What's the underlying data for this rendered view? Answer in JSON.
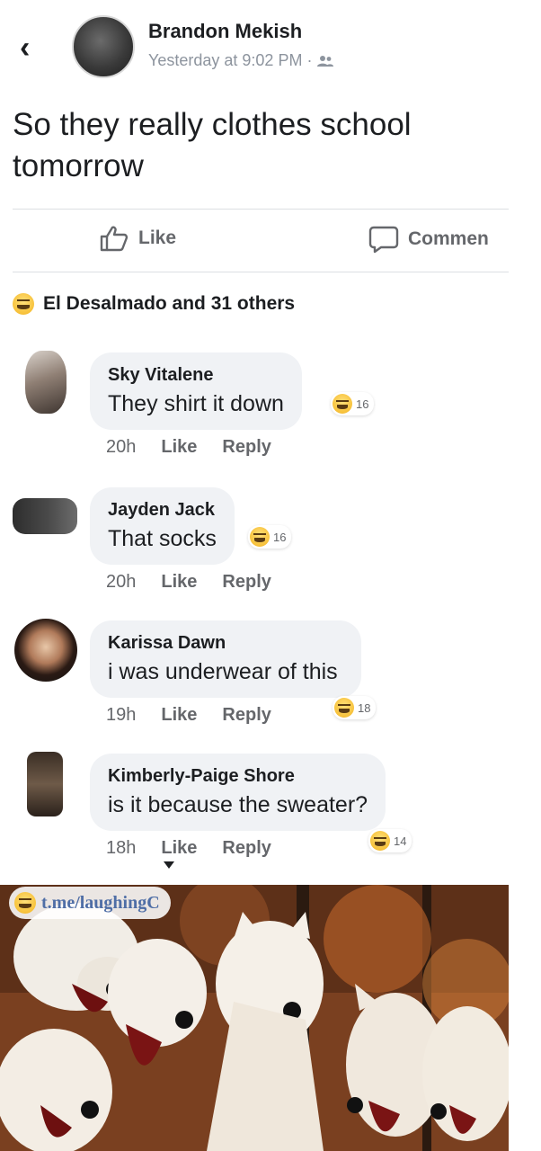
{
  "post": {
    "author": "Brandon Mekish",
    "meta": "Yesterday at 9:02 PM ·",
    "audience_icon": "friends-icon",
    "text": "So they really clothes school tomorrow"
  },
  "actions": {
    "like_label": "Like",
    "comment_label": "Commen"
  },
  "reactions": {
    "summary": "El Desalmado and 31 others",
    "icon": "haha-icon"
  },
  "comments": [
    {
      "name": "Sky Vitalene",
      "text": "They shirt it down",
      "reaction_count": "16",
      "time": "20h",
      "like": "Like",
      "reply": "Reply"
    },
    {
      "name": "Jayden Jack",
      "text": "That socks",
      "reaction_count": "16",
      "time": "20h",
      "like": "Like",
      "reply": "Reply"
    },
    {
      "name": "Karissa Dawn",
      "text": "i was underwear of this",
      "reaction_count": "18",
      "time": "19h",
      "like": "Like",
      "reply": "Reply"
    },
    {
      "name": "Kimberly-Paige Shore",
      "text": "is it because the sweater?",
      "reaction_count": "14",
      "time": "18h",
      "like": "Like",
      "reply": "Reply"
    }
  ],
  "watermark": {
    "text": "t.me/laughingC"
  },
  "colors": {
    "text": "#1c1e21",
    "muted": "#65676b",
    "bubble": "#f0f2f5",
    "haha": "#f7c13a"
  }
}
